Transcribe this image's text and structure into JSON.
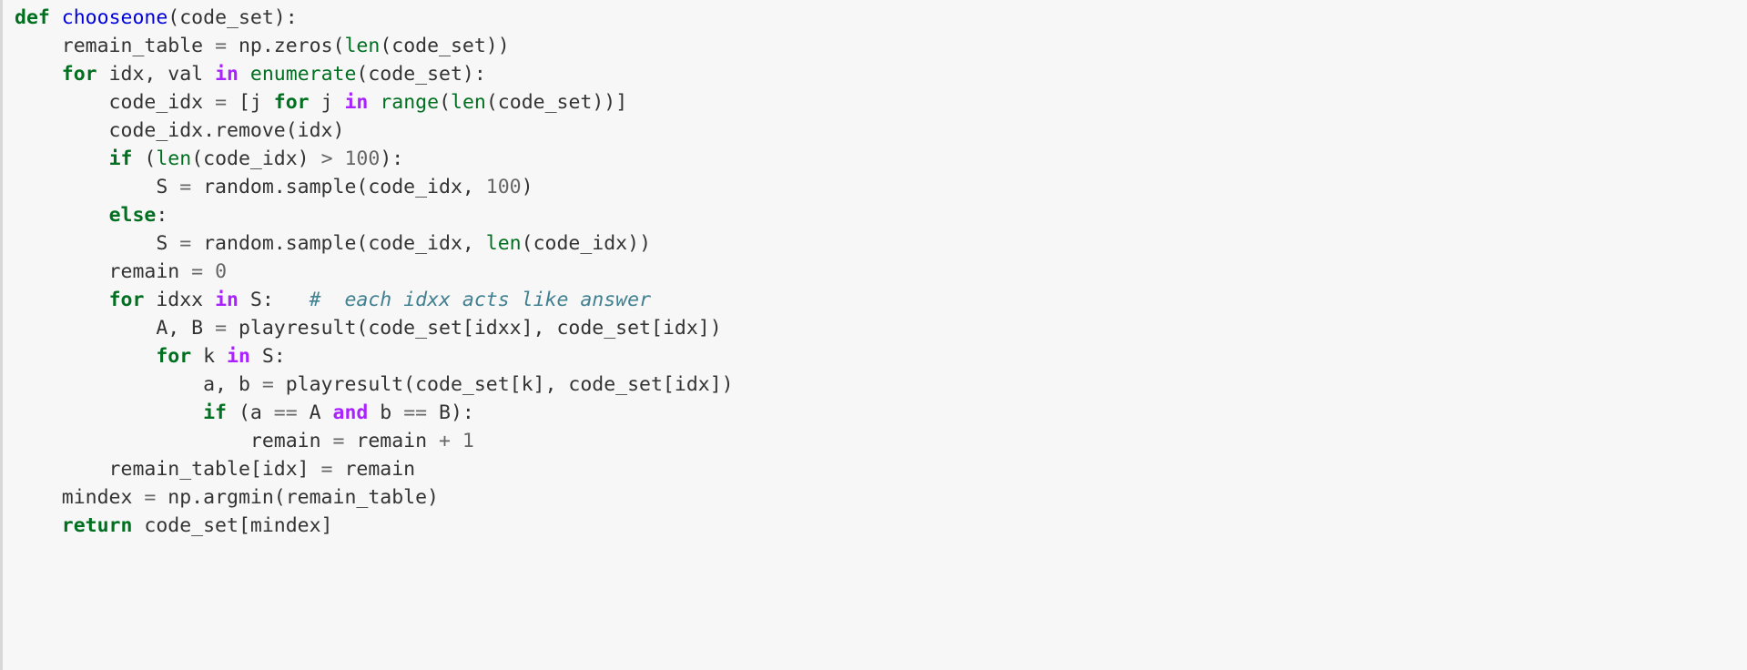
{
  "code_block": {
    "language": "python",
    "background_color": "#f7f7f7",
    "border_color": "#d8d8d8",
    "theme_colors": {
      "keyword": "#007020",
      "keyword_operator": "#aa22ff",
      "function_name": "#0000dd",
      "builtin": "#007020",
      "number": "#666666",
      "operator": "#666666",
      "comment": "#408090",
      "plain_text": "#333333"
    },
    "plain_text": "def chooseone(code_set):\n    remain_table = np.zeros(len(code_set))\n    for idx, val in enumerate(code_set):\n        code_idx = [j for j in range(len(code_set))]\n        code_idx.remove(idx)\n        if (len(code_idx) > 100):\n            S = random.sample(code_idx, 100)\n        else:\n            S = random.sample(code_idx, len(code_idx))\n        remain = 0\n        for idxx in S:   # each idxx acts like answer\n            A, B = playresult(code_set[idxx], code_set[idx])\n            for k in S:\n                a, b = playresult(code_set[k], code_set[idx])\n                if (a == A and b == B):\n                    remain = remain + 1\n        remain_table[idx] = remain\n    mindex = np.argmin(remain_table)\n    return code_set[mindex]",
    "lines": [
      {
        "n": 1,
        "tokens": [
          {
            "t": "def",
            "c": "tok-kw"
          },
          {
            "t": " ",
            "c": "tok-name"
          },
          {
            "t": "chooseone",
            "c": "tok-fname"
          },
          {
            "t": "(code_set):",
            "c": "tok-punct"
          }
        ]
      },
      {
        "n": 2,
        "tokens": [
          {
            "t": "    remain_table ",
            "c": "tok-name"
          },
          {
            "t": "=",
            "c": "tok-op"
          },
          {
            "t": " np.zeros(",
            "c": "tok-name"
          },
          {
            "t": "len",
            "c": "tok-builtin"
          },
          {
            "t": "(code_set))",
            "c": "tok-name"
          }
        ]
      },
      {
        "n": 3,
        "tokens": [
          {
            "t": "    ",
            "c": "tok-name"
          },
          {
            "t": "for",
            "c": "tok-kw"
          },
          {
            "t": " idx, val ",
            "c": "tok-name"
          },
          {
            "t": "in",
            "c": "tok-kw-op"
          },
          {
            "t": " ",
            "c": "tok-name"
          },
          {
            "t": "enumerate",
            "c": "tok-builtin"
          },
          {
            "t": "(code_set):",
            "c": "tok-name"
          }
        ]
      },
      {
        "n": 4,
        "tokens": [
          {
            "t": "        code_idx ",
            "c": "tok-name"
          },
          {
            "t": "=",
            "c": "tok-op"
          },
          {
            "t": " [j ",
            "c": "tok-name"
          },
          {
            "t": "for",
            "c": "tok-kw"
          },
          {
            "t": " j ",
            "c": "tok-name"
          },
          {
            "t": "in",
            "c": "tok-kw-op"
          },
          {
            "t": " ",
            "c": "tok-name"
          },
          {
            "t": "range",
            "c": "tok-builtin"
          },
          {
            "t": "(",
            "c": "tok-name"
          },
          {
            "t": "len",
            "c": "tok-builtin"
          },
          {
            "t": "(code_set))]",
            "c": "tok-name"
          }
        ]
      },
      {
        "n": 5,
        "tokens": [
          {
            "t": "        code_idx.remove(idx)",
            "c": "tok-name"
          }
        ]
      },
      {
        "n": 6,
        "tokens": [
          {
            "t": "        ",
            "c": "tok-name"
          },
          {
            "t": "if",
            "c": "tok-kw"
          },
          {
            "t": " (",
            "c": "tok-name"
          },
          {
            "t": "len",
            "c": "tok-builtin"
          },
          {
            "t": "(code_idx) ",
            "c": "tok-name"
          },
          {
            "t": ">",
            "c": "tok-op"
          },
          {
            "t": " ",
            "c": "tok-name"
          },
          {
            "t": "100",
            "c": "tok-num"
          },
          {
            "t": "):",
            "c": "tok-name"
          }
        ]
      },
      {
        "n": 7,
        "tokens": [
          {
            "t": "            S ",
            "c": "tok-name"
          },
          {
            "t": "=",
            "c": "tok-op"
          },
          {
            "t": " random.sample(code_idx, ",
            "c": "tok-name"
          },
          {
            "t": "100",
            "c": "tok-num"
          },
          {
            "t": ")",
            "c": "tok-name"
          }
        ]
      },
      {
        "n": 8,
        "tokens": [
          {
            "t": "        ",
            "c": "tok-name"
          },
          {
            "t": "else",
            "c": "tok-kw"
          },
          {
            "t": ":",
            "c": "tok-name"
          }
        ]
      },
      {
        "n": 9,
        "tokens": [
          {
            "t": "            S ",
            "c": "tok-name"
          },
          {
            "t": "=",
            "c": "tok-op"
          },
          {
            "t": " random.sample(code_idx, ",
            "c": "tok-name"
          },
          {
            "t": "len",
            "c": "tok-builtin"
          },
          {
            "t": "(code_idx))",
            "c": "tok-name"
          }
        ]
      },
      {
        "n": 10,
        "tokens": [
          {
            "t": "        remain ",
            "c": "tok-name"
          },
          {
            "t": "=",
            "c": "tok-op"
          },
          {
            "t": " ",
            "c": "tok-name"
          },
          {
            "t": "0",
            "c": "tok-num"
          }
        ]
      },
      {
        "n": 11,
        "tokens": [
          {
            "t": "        ",
            "c": "tok-name"
          },
          {
            "t": "for",
            "c": "tok-kw"
          },
          {
            "t": " idxx ",
            "c": "tok-name"
          },
          {
            "t": "in",
            "c": "tok-kw-op"
          },
          {
            "t": " S:   ",
            "c": "tok-name"
          },
          {
            "t": "#  each idxx acts like answer",
            "c": "tok-comment"
          }
        ]
      },
      {
        "n": 12,
        "tokens": [
          {
            "t": "            A, B ",
            "c": "tok-name"
          },
          {
            "t": "=",
            "c": "tok-op"
          },
          {
            "t": " playresult(code_set[idxx], code_set[idx])",
            "c": "tok-name"
          }
        ]
      },
      {
        "n": 13,
        "tokens": [
          {
            "t": "            ",
            "c": "tok-name"
          },
          {
            "t": "for",
            "c": "tok-kw"
          },
          {
            "t": " k ",
            "c": "tok-name"
          },
          {
            "t": "in",
            "c": "tok-kw-op"
          },
          {
            "t": " S:",
            "c": "tok-name"
          }
        ]
      },
      {
        "n": 14,
        "tokens": [
          {
            "t": "                a, b ",
            "c": "tok-name"
          },
          {
            "t": "=",
            "c": "tok-op"
          },
          {
            "t": " playresult(code_set[k], code_set[idx])",
            "c": "tok-name"
          }
        ]
      },
      {
        "n": 15,
        "tokens": [
          {
            "t": "                ",
            "c": "tok-name"
          },
          {
            "t": "if",
            "c": "tok-kw"
          },
          {
            "t": " (a ",
            "c": "tok-name"
          },
          {
            "t": "==",
            "c": "tok-op"
          },
          {
            "t": " A ",
            "c": "tok-name"
          },
          {
            "t": "and",
            "c": "tok-kw-op"
          },
          {
            "t": " b ",
            "c": "tok-name"
          },
          {
            "t": "==",
            "c": "tok-op"
          },
          {
            "t": " B):",
            "c": "tok-name"
          }
        ]
      },
      {
        "n": 16,
        "tokens": [
          {
            "t": "                    remain ",
            "c": "tok-name"
          },
          {
            "t": "=",
            "c": "tok-op"
          },
          {
            "t": " remain ",
            "c": "tok-name"
          },
          {
            "t": "+",
            "c": "tok-op"
          },
          {
            "t": " ",
            "c": "tok-name"
          },
          {
            "t": "1",
            "c": "tok-num"
          }
        ]
      },
      {
        "n": 17,
        "tokens": [
          {
            "t": "        remain_table[idx] ",
            "c": "tok-name"
          },
          {
            "t": "=",
            "c": "tok-op"
          },
          {
            "t": " remain",
            "c": "tok-name"
          }
        ]
      },
      {
        "n": 18,
        "tokens": [
          {
            "t": "    mindex ",
            "c": "tok-name"
          },
          {
            "t": "=",
            "c": "tok-op"
          },
          {
            "t": " np.argmin(remain_table)",
            "c": "tok-name"
          }
        ]
      },
      {
        "n": 19,
        "tokens": [
          {
            "t": "    ",
            "c": "tok-name"
          },
          {
            "t": "return",
            "c": "tok-kw"
          },
          {
            "t": " code_set[mindex]",
            "c": "tok-name"
          }
        ]
      }
    ]
  }
}
